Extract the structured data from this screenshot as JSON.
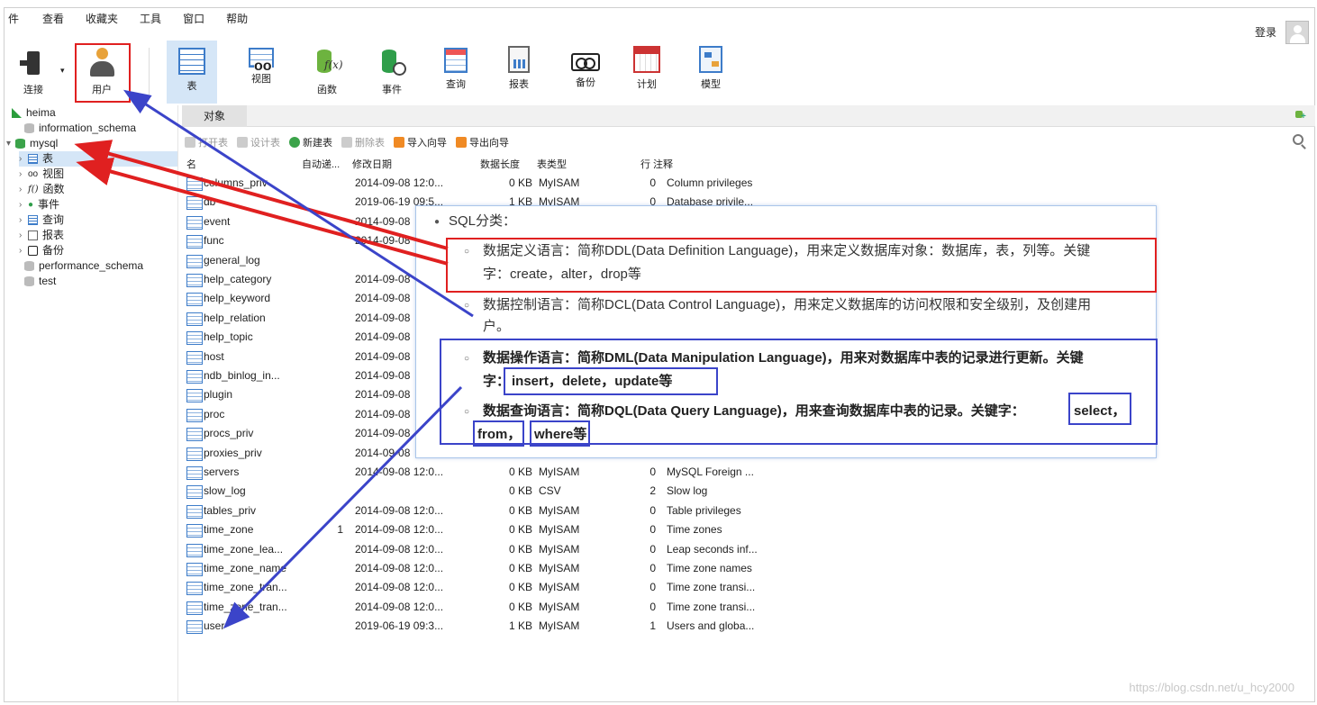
{
  "menu": [
    "件",
    "查看",
    "收藏夹",
    "工具",
    "窗口",
    "帮助"
  ],
  "login_label": "登录",
  "toolbar": [
    {
      "label": "连接",
      "icon": "connection-icon"
    },
    {
      "label": "用户",
      "icon": "user-icon"
    },
    {
      "label": "表",
      "icon": "table-icon"
    },
    {
      "label": "视图",
      "icon": "view-icon"
    },
    {
      "label": "函数",
      "icon": "function-icon"
    },
    {
      "label": "事件",
      "icon": "event-icon"
    },
    {
      "label": "查询",
      "icon": "query-icon"
    },
    {
      "label": "报表",
      "icon": "report-icon"
    },
    {
      "label": "备份",
      "icon": "backup-icon"
    },
    {
      "label": "计划",
      "icon": "schedule-icon"
    },
    {
      "label": "模型",
      "icon": "model-icon"
    }
  ],
  "tree": {
    "root": "heima",
    "databases": [
      "information_schema",
      "mysql",
      "performance_schema",
      "test"
    ],
    "mysql_children": [
      {
        "label": "表",
        "icon": "table-icon"
      },
      {
        "label": "视图",
        "icon": "view-icon"
      },
      {
        "label": "函数",
        "icon": "function-icon"
      },
      {
        "label": "事件",
        "icon": "event-icon"
      },
      {
        "label": "查询",
        "icon": "query-icon"
      },
      {
        "label": "报表",
        "icon": "report-icon"
      },
      {
        "label": "备份",
        "icon": "backup-icon"
      }
    ]
  },
  "object_tab": "对象",
  "subtoolbar": [
    "打开表",
    "设计表",
    "新建表",
    "删除表",
    "导入向导",
    "导出向导"
  ],
  "grid": {
    "headers": [
      "名",
      "自动递...",
      "修改日期",
      "数据长度",
      "表类型",
      "行",
      "注释"
    ],
    "rows": [
      {
        "name": "columns_priv",
        "auto": "",
        "date": "2014-09-08 12:0...",
        "size": "0 KB",
        "engine": "MyISAM",
        "rows": "0",
        "comment": "Column privileges"
      },
      {
        "name": "db",
        "auto": "",
        "date": "2019-06-19 09:5...",
        "size": "1 KB",
        "engine": "MyISAM",
        "rows": "0",
        "comment": "Database privile..."
      },
      {
        "name": "event",
        "auto": "",
        "date": "2014-09-08",
        "size": "",
        "engine": "",
        "rows": "",
        "comment": ""
      },
      {
        "name": "func",
        "auto": "",
        "date": "2014-09-08",
        "size": "",
        "engine": "",
        "rows": "",
        "comment": ""
      },
      {
        "name": "general_log",
        "auto": "",
        "date": "",
        "size": "",
        "engine": "",
        "rows": "",
        "comment": ""
      },
      {
        "name": "help_category",
        "auto": "",
        "date": "2014-09-08",
        "size": "",
        "engine": "",
        "rows": "",
        "comment": ""
      },
      {
        "name": "help_keyword",
        "auto": "",
        "date": "2014-09-08",
        "size": "",
        "engine": "",
        "rows": "",
        "comment": ""
      },
      {
        "name": "help_relation",
        "auto": "",
        "date": "2014-09-08",
        "size": "",
        "engine": "",
        "rows": "",
        "comment": ""
      },
      {
        "name": "help_topic",
        "auto": "",
        "date": "2014-09-08",
        "size": "",
        "engine": "",
        "rows": "",
        "comment": ""
      },
      {
        "name": "host",
        "auto": "",
        "date": "2014-09-08",
        "size": "",
        "engine": "",
        "rows": "",
        "comment": ""
      },
      {
        "name": "ndb_binlog_in...",
        "auto": "",
        "date": "2014-09-08",
        "size": "",
        "engine": "",
        "rows": "",
        "comment": ""
      },
      {
        "name": "plugin",
        "auto": "",
        "date": "2014-09-08",
        "size": "",
        "engine": "",
        "rows": "",
        "comment": ""
      },
      {
        "name": "proc",
        "auto": "",
        "date": "2014-09-08",
        "size": "",
        "engine": "",
        "rows": "",
        "comment": ""
      },
      {
        "name": "procs_priv",
        "auto": "",
        "date": "2014-09-08",
        "size": "",
        "engine": "",
        "rows": "",
        "comment": ""
      },
      {
        "name": "proxies_priv",
        "auto": "",
        "date": "2014-09-08",
        "size": "",
        "engine": "",
        "rows": "",
        "comment": ""
      },
      {
        "name": "servers",
        "auto": "",
        "date": "2014-09-08 12:0...",
        "size": "0 KB",
        "engine": "MyISAM",
        "rows": "0",
        "comment": "MySQL Foreign ..."
      },
      {
        "name": "slow_log",
        "auto": "",
        "date": "",
        "size": "0 KB",
        "engine": "CSV",
        "rows": "2",
        "comment": "Slow log"
      },
      {
        "name": "tables_priv",
        "auto": "",
        "date": "2014-09-08 12:0...",
        "size": "0 KB",
        "engine": "MyISAM",
        "rows": "0",
        "comment": "Table privileges"
      },
      {
        "name": "time_zone",
        "auto": "1",
        "date": "2014-09-08 12:0...",
        "size": "0 KB",
        "engine": "MyISAM",
        "rows": "0",
        "comment": "Time zones"
      },
      {
        "name": "time_zone_lea...",
        "auto": "",
        "date": "2014-09-08 12:0...",
        "size": "0 KB",
        "engine": "MyISAM",
        "rows": "0",
        "comment": "Leap seconds inf..."
      },
      {
        "name": "time_zone_name",
        "auto": "",
        "date": "2014-09-08 12:0...",
        "size": "0 KB",
        "engine": "MyISAM",
        "rows": "0",
        "comment": "Time zone names"
      },
      {
        "name": "time_zone_tran...",
        "auto": "",
        "date": "2014-09-08 12:0...",
        "size": "0 KB",
        "engine": "MyISAM",
        "rows": "0",
        "comment": "Time zone transi..."
      },
      {
        "name": "time_zone_tran...",
        "auto": "",
        "date": "2014-09-08 12:0...",
        "size": "0 KB",
        "engine": "MyISAM",
        "rows": "0",
        "comment": "Time zone transi..."
      },
      {
        "name": "user",
        "auto": "",
        "date": "2019-06-19 09:3...",
        "size": "1 KB",
        "engine": "MyISAM",
        "rows": "1",
        "comment": "Users and globa..."
      }
    ]
  },
  "popup": {
    "heading": "SQL分类：",
    "ddl_line1": "数据定义语言：简称DDL(Data Definition Language)，用来定义数据库对象：数据库，表，列等。关键",
    "ddl_line2": "字：create，alter，drop等",
    "dcl_line1": "数据控制语言：简称DCL(Data Control Language)，用来定义数据库的访问权限和安全级别，及创建用",
    "dcl_line2": "户。",
    "dml_line1": "数据操作语言：简称DML(Data Manipulation Language)，用来对数据库中表的记录进行更新。关键",
    "dml_prefix": "字：",
    "dml_keywords": "insert，delete，update等",
    "dql_line1_text": "数据查询语言：简称DQL(Data Query Language)，用来查询数据库中表的记录。关键字：",
    "dql_select": "select，",
    "dql_from": "from，",
    "dql_where": "where等"
  },
  "watermark": "https://blog.csdn.net/u_hcy2000",
  "colors": {
    "annotation_red": "#e02020",
    "annotation_blue": "#3b44c9",
    "selection": "#d5e6f7"
  }
}
